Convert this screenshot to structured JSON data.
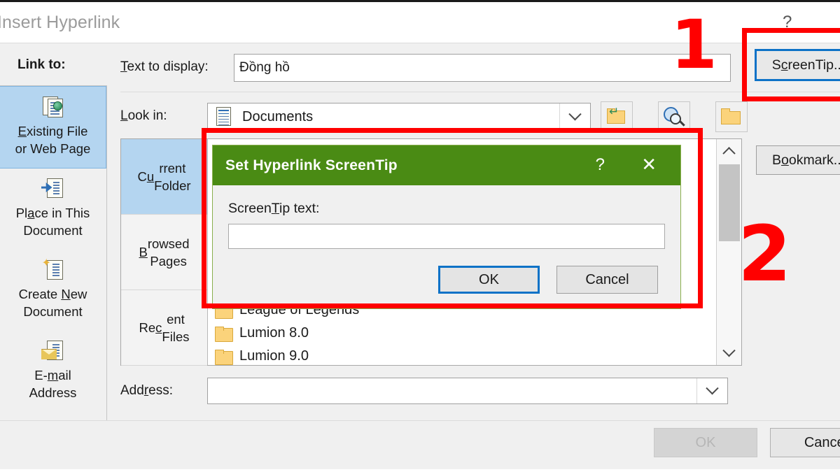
{
  "window": {
    "title": "Insert Hyperlink",
    "help_glyph": "?"
  },
  "link_to": {
    "label": "Link to:",
    "items": [
      {
        "label": "Existing File\nor Web Page",
        "icon": "existing-file-or-web-page-icon",
        "selected": true
      },
      {
        "label": "Place in This\nDocument",
        "icon": "place-in-this-document-icon",
        "selected": false
      },
      {
        "label": "Create New\nDocument",
        "icon": "create-new-document-icon",
        "selected": false
      },
      {
        "label": "E-mail\nAddress",
        "icon": "email-address-icon",
        "selected": false
      }
    ]
  },
  "text_to_display": {
    "label": "Text to display:",
    "value": "Đồng hồ",
    "placeholder": ""
  },
  "look_in": {
    "label": "Look in:",
    "value": "Documents",
    "icon": "documents-folder-icon",
    "dropdown_glyph": "v",
    "toolbar": [
      {
        "name": "browse-up-one-folder-icon",
        "glyph": "up-folder"
      },
      {
        "name": "browse-the-web-icon",
        "glyph": "globe-search"
      },
      {
        "name": "browse-for-file-icon",
        "glyph": "open-folder"
      }
    ]
  },
  "browser": {
    "tabs": [
      {
        "label": "Current\nFolder",
        "selected": true
      },
      {
        "label": "Browsed\nPages",
        "selected": false
      },
      {
        "label": "Recent\nFiles",
        "selected": false
      }
    ],
    "files": [
      {
        "name": "League of Legends",
        "icon": "folder-icon"
      },
      {
        "name": "Lumion 8.0",
        "icon": "folder-icon"
      },
      {
        "name": "Lumion 9.0",
        "icon": "folder-icon"
      }
    ],
    "scroll_up_glyph": "^",
    "scroll_down_glyph": "v"
  },
  "address": {
    "label": "Address:",
    "value": "",
    "placeholder": "",
    "dropdown_glyph": "v"
  },
  "side_buttons": {
    "screentip": "ScreenTip...",
    "bookmark": "Bookmark...",
    "target_frame": ""
  },
  "footer": {
    "ok": "OK",
    "ok_disabled": true,
    "cancel": "Cancel"
  },
  "screentip_dialog": {
    "title": "Set Hyperlink ScreenTip",
    "help_glyph": "?",
    "close_glyph": "✕",
    "field_label": "ScreenTip text:",
    "field_value": "",
    "ok": "OK",
    "cancel": "Cancel",
    "title_bg": "#4a8b14"
  },
  "annotations": {
    "marker_one": "1",
    "marker_two": "2",
    "color": "#ff0000"
  }
}
